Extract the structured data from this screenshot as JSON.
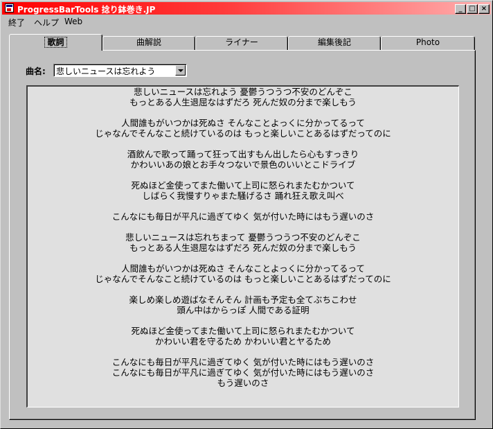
{
  "window": {
    "title": "ProgressBarTools  捻り鉢巻き.JP",
    "buttons": {
      "minimize": "_",
      "maximize": "□",
      "close": "×"
    }
  },
  "menu": [
    "終了",
    "ヘルプ",
    "Web"
  ],
  "tabs": [
    "歌詞",
    "曲解説",
    "ライナー",
    "編集後記",
    "Photo"
  ],
  "active_tab": "歌詞",
  "song": {
    "label": "曲名:",
    "value": "悲しいニュースは忘れよう"
  },
  "lyrics": [
    [
      "悲しいニュースは忘れよう 憂鬱うつうつ不安のどんぞこ",
      "もっとある人生退屈なはずだろ 死んだ奴の分まで楽しもう"
    ],
    [
      "人間誰もがいつかは死ぬさ そんなことよっくに分かってるって",
      "じゃなんでそんなこと続けているのは もっと楽しいことあるはずだってのに"
    ],
    [
      "酒飲んで歌って踊って狂って出すもん出したら心もすっきり",
      "かわいいあの娘とお手々つないで景色のいいとこドライブ"
    ],
    [
      "死ぬほど金使ってまた働いて上司に怒られまたむかついて",
      "しばらく我慢すりゃまた騒げるさ 踊れ狂え歌え叫べ"
    ],
    [
      "こんなにも毎日が平凡に過ぎてゆく 気が付いた時にはもう遅いのさ"
    ],
    [
      "悲しいニュースは忘れちまって 憂鬱うつうつ不安のどんぞこ",
      "もっとある人生退屈なはずだろ 死んだ奴の分まで楽しもう"
    ],
    [
      "人間誰もがいつかは死ぬさ そんなことよっくに分かってるって",
      "じゃなんでそんなこと続けているのは もっと楽しいことあるはずだってのに"
    ],
    [
      "楽しめ楽しめ遊ばなそんそん 計画も予定も全てぶちこわせ",
      "頭ん中はからっぽ 人間である証明"
    ],
    [
      "死ぬほど金使ってまた働いて上司に怒られまたむかついて",
      "かわいい君を守るため かわいい君とヤるため"
    ],
    [
      "こんなにも毎日が平凡に過ぎてゆく 気が付いた時にはもう遅いのさ",
      "こんなにも毎日が平凡に過ぎてゆく 気が付いた時にはもう遅いのさ",
      "もう遅いのさ"
    ]
  ]
}
